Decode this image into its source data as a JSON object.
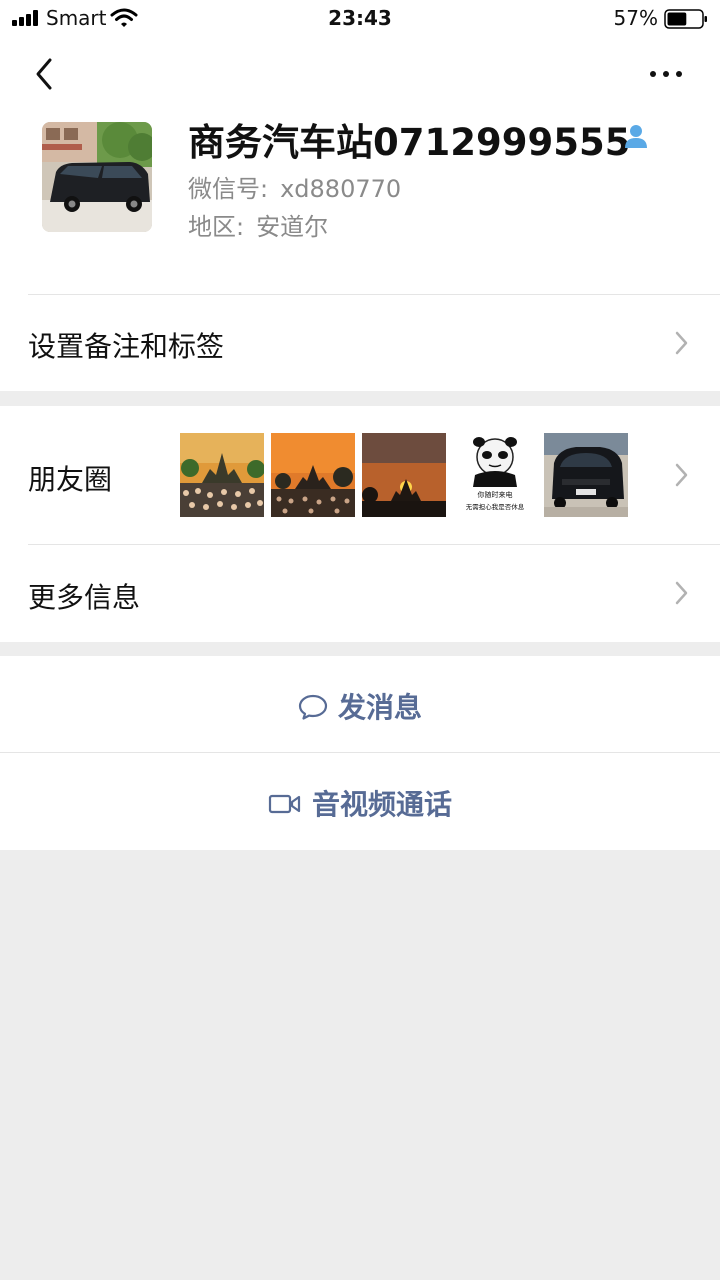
{
  "status_bar": {
    "carrier": "Smart",
    "time": "23:43",
    "battery_percent": "57%",
    "battery_level": 0.57
  },
  "nav": {
    "back_icon": "chevron-left-icon",
    "more_icon": "more-dots-icon"
  },
  "profile": {
    "name": "商务汽车站0712999555",
    "contact_icon": "person-icon",
    "wechat_id_label": "微信号:",
    "wechat_id": "xd880770",
    "region_label": "地区:",
    "region": "安道尔"
  },
  "rows": {
    "remark_label": "设置备注和标签",
    "moments_label": "朋友圈",
    "more_info_label": "更多信息"
  },
  "moments_thumbnails": {
    "panda_caption_1": "你随时来电",
    "panda_caption_2": "无需担心我是否休息"
  },
  "actions": {
    "message_label": "发消息",
    "message_icon": "chat-bubble-icon",
    "call_label": "音视频通话",
    "call_icon": "video-camera-icon"
  },
  "colors": {
    "link_blue": "#576b95",
    "background": "#ededed",
    "secondary_text": "#8a8a8a"
  }
}
